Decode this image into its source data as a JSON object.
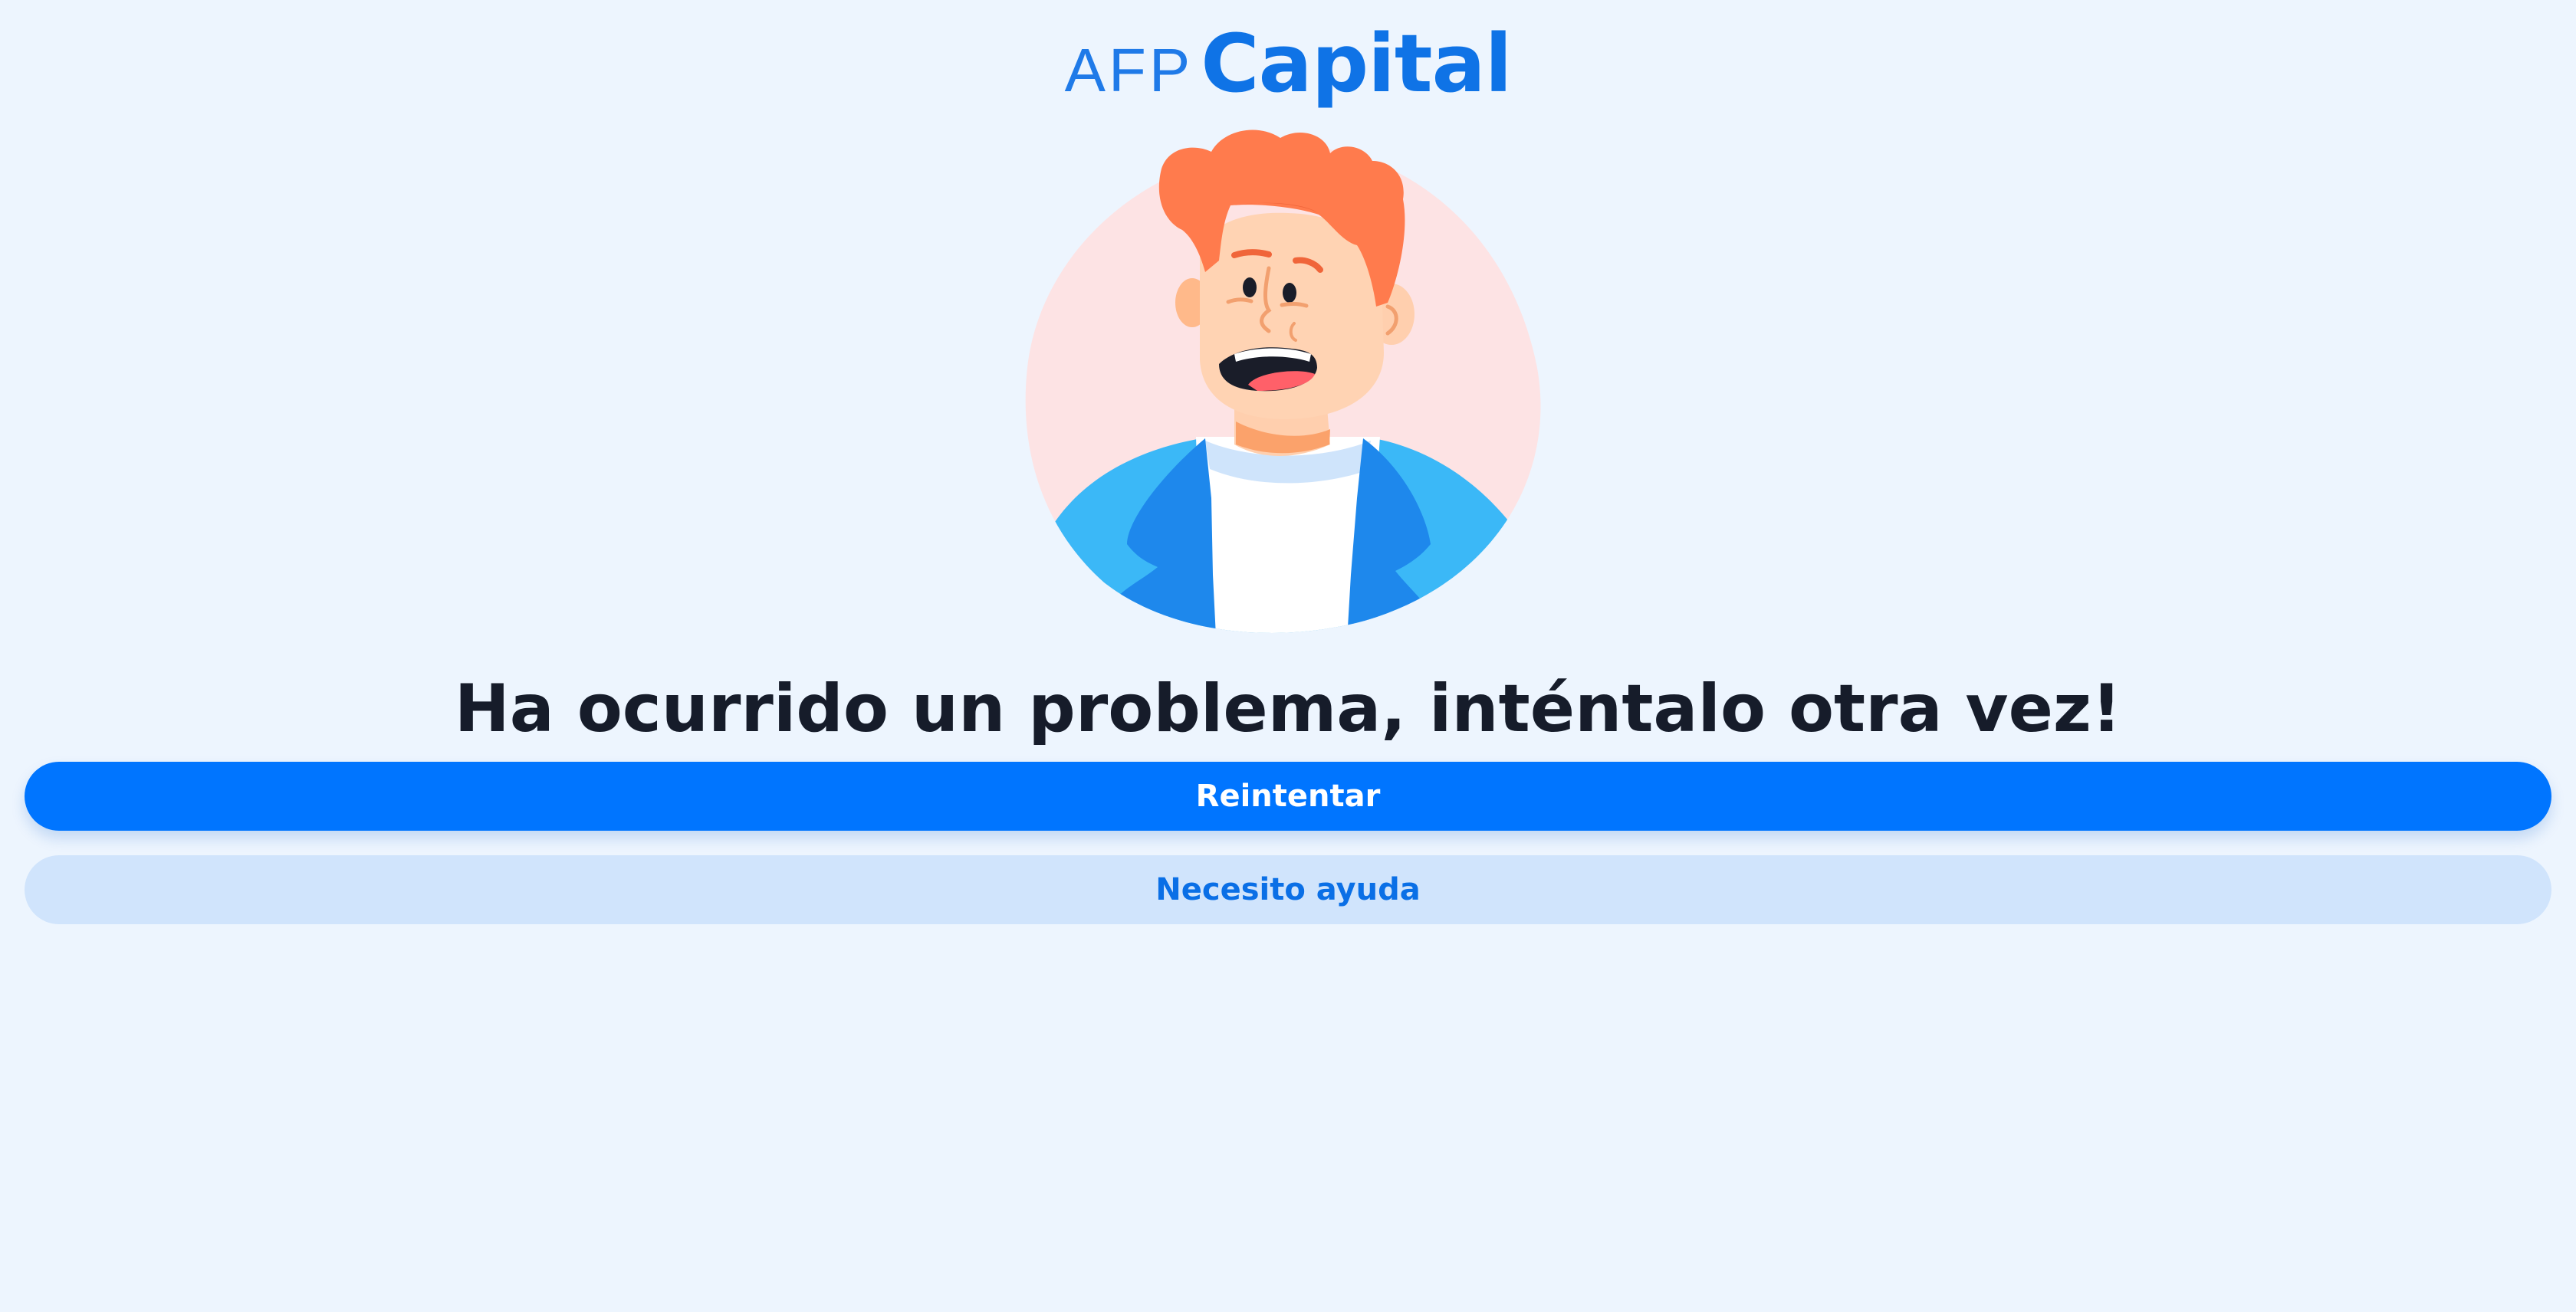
{
  "brand": {
    "prefix": "AFP",
    "name": "Capital",
    "color": "#0f73e6"
  },
  "illustration": {
    "icon": "worried-person-illustration"
  },
  "message": {
    "title": "Ha ocurrido un problema, inténtalo otra vez!"
  },
  "actions": {
    "retry_label": "Reintentar",
    "help_label": "Necesito ayuda"
  },
  "colors": {
    "background": "#edf5fe",
    "primary": "#0075ff",
    "secondary_bg": "#d0e4fc",
    "text": "#161c2a"
  }
}
